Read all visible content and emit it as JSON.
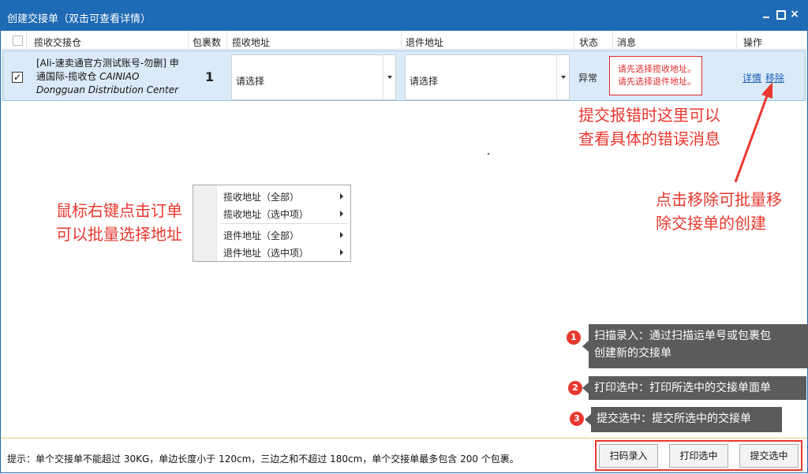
{
  "window": {
    "title": "创建交接单（双击可查看详情）",
    "controls": {
      "minimize": "",
      "maximize": "",
      "close": "×"
    }
  },
  "table": {
    "headers": [
      "揽收交接仓",
      "包裹数",
      "揽收地址",
      "退件地址",
      "状态",
      "消息",
      "操作"
    ],
    "rows": [
      {
        "checked": "✓",
        "warehouse_cn": "[Ali-速卖通官方测试账号-勿删] 申通国际-揽收仓 ",
        "warehouse_en": "CAINIAO Dongguan Distribution Center",
        "count": "1",
        "pickup_address": "请选择",
        "return_address": "请选择",
        "status": "异常",
        "message_line1": "请先选择揽收地址。",
        "message_line2": "请先选择退件地址。",
        "action_detail": "详情",
        "action_remove": "移除"
      }
    ]
  },
  "context_menu": {
    "items": [
      "揽收地址（全部）",
      "揽收地址（选中项）",
      "退件地址（全部）",
      "退件地址（选中项）"
    ]
  },
  "annotations": {
    "error_note_line1": "提交报错时这里可以",
    "error_note_line2": "查看具体的错误消息",
    "remove_note_line1": "点击移除可批量移",
    "remove_note_line2": "除交接单的创建",
    "rightclick_note_line1": "鼠标右键点击订单",
    "rightclick_note_line2": "可以批量选择地址"
  },
  "tips": [
    {
      "badge": "1",
      "line1": "扫描录入：通过扫描运单号或包裹包",
      "line2": "创建新的交接单"
    },
    {
      "badge": "2",
      "line1": "打印选中：打印所选中的交接单面单"
    },
    {
      "badge": "3",
      "line1": "提交选中：提交所选中的交接单"
    }
  ],
  "footer": {
    "hint": "提示：单个交接单不能超过 30KG，单边长度小于 120cm，三边之和不超过 180cm，单个交接单最多包含 200 个包裹。",
    "buttons": {
      "scan": "扫码录入",
      "print": "打印选中",
      "submit": "提交选中"
    }
  },
  "colors": {
    "titlebar": "#1e6ab4",
    "annotation": "#e8382f",
    "row_selected": "#dbeaf9",
    "tip_bg": "#5b5b5b"
  }
}
